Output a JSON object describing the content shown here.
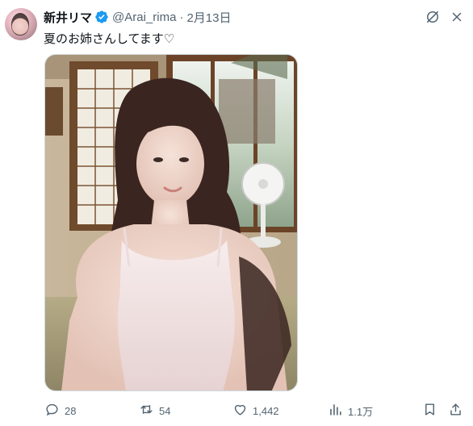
{
  "tweet": {
    "author_name": "新井リマ",
    "handle": "@Arai_rima",
    "separator": "·",
    "date": "2月13日",
    "text": "夏のお姉さんしてます♡"
  },
  "icons": {
    "verified": "verified-badge-icon",
    "grok": "grok-icon",
    "more": "more-icon",
    "reply": "reply-icon",
    "repost": "repost-icon",
    "like": "like-icon",
    "views": "views-icon",
    "bookmark": "bookmark-icon",
    "share": "share-icon"
  },
  "metrics": {
    "replies": "28",
    "reposts": "54",
    "likes": "1,442",
    "views": "1.1万"
  },
  "colors": {
    "verified": "#1d9bf0",
    "text_secondary": "#536471",
    "text_primary": "#0f1419"
  }
}
